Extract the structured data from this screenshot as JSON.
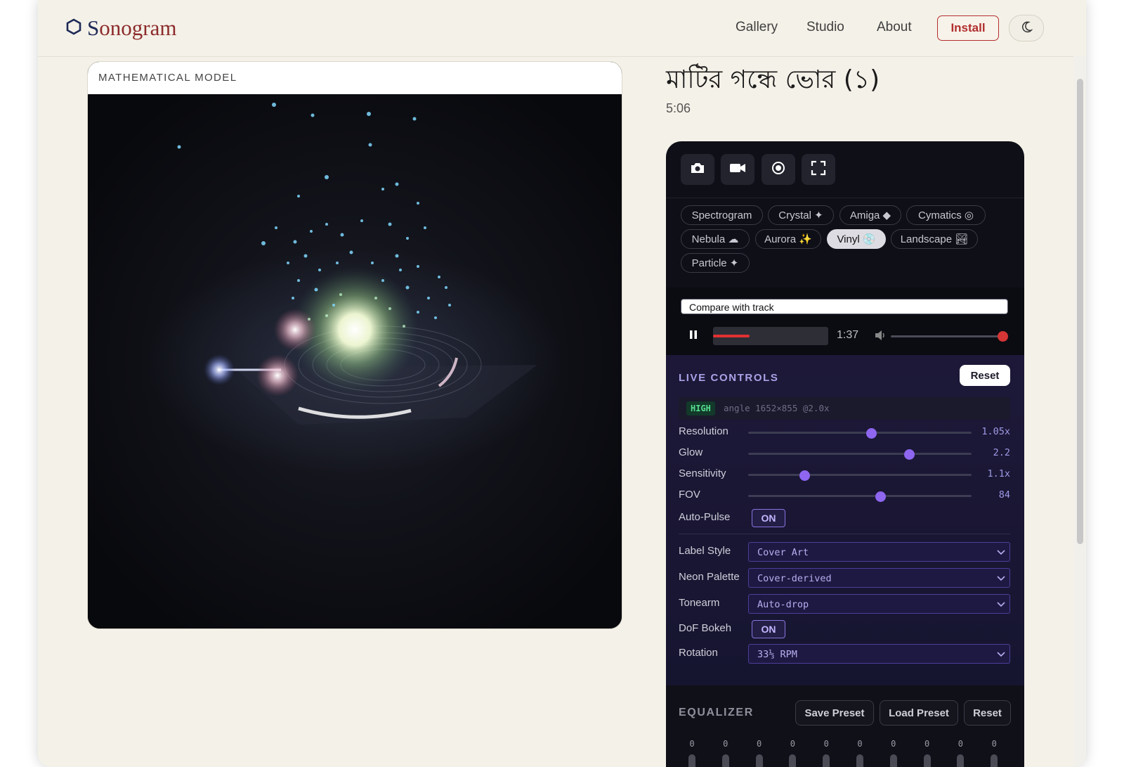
{
  "header": {
    "logo_prefix": "S",
    "logo_rest": "onogram",
    "nav": [
      "Gallery",
      "Studio",
      "About"
    ],
    "install_label": "Install",
    "theme_icon": "moon-icon"
  },
  "visual": {
    "label": "MATHEMATICAL MODEL"
  },
  "track": {
    "title": "মাটির গন্ধে ভোর (১)",
    "duration": "5:06"
  },
  "toolbar": {
    "icons": [
      "camera-icon",
      "video-icon",
      "record-icon",
      "fullscreen-icon"
    ]
  },
  "modes": [
    {
      "label": "Spectrogram"
    },
    {
      "label": "Crystal ✦"
    },
    {
      "label": "Amiga ◆"
    },
    {
      "label": "Cymatics ◎"
    },
    {
      "label": "Nebula ☁"
    },
    {
      "label": "Aurora ✨"
    },
    {
      "label": "Vinyl 💿",
      "active": true
    },
    {
      "label": "Landscape 🏞"
    },
    {
      "label": "Particle ✦"
    }
  ],
  "player": {
    "compare_label": "Compare with track",
    "time": "1:37",
    "progress": 0.32,
    "volume": 1.0
  },
  "live_controls": {
    "title": "LIVE CONTROLS",
    "reset_label": "Reset",
    "quality_badge": "HIGH",
    "quality_info": "angle 1652×855 @2.0x",
    "sliders": [
      {
        "label": "Resolution",
        "value": "1.05x",
        "position": 0.55
      },
      {
        "label": "Glow",
        "value": "2.2",
        "position": 0.72
      },
      {
        "label": "Sensitivity",
        "value": "1.1x",
        "position": 0.25
      },
      {
        "label": "FOV",
        "value": "84",
        "position": 0.59
      }
    ],
    "auto_pulse_label": "Auto-Pulse",
    "auto_pulse_value": "ON",
    "label_style_label": "Label Style",
    "label_style_value": "Cover Art",
    "neon_palette_label": "Neon Palette",
    "neon_palette_value": "Cover-derived",
    "tonearm_label": "Tonearm",
    "tonearm_value": "Auto-drop",
    "dof_label": "DoF Bokeh",
    "dof_value": "ON",
    "rotation_label": "Rotation",
    "rotation_value": "33⅓ RPM"
  },
  "equalizer": {
    "title": "EQUALIZER",
    "save_label": "Save Preset",
    "load_label": "Load Preset",
    "reset_label": "Reset",
    "bands": [
      "0",
      "0",
      "0",
      "0",
      "0",
      "0",
      "0",
      "0",
      "0",
      "0"
    ]
  },
  "colors": {
    "brand_navy": "#1d2a57",
    "brand_red": "#b22e2e",
    "accent_purple": "#8e66f0",
    "progress_red": "#e03131"
  }
}
